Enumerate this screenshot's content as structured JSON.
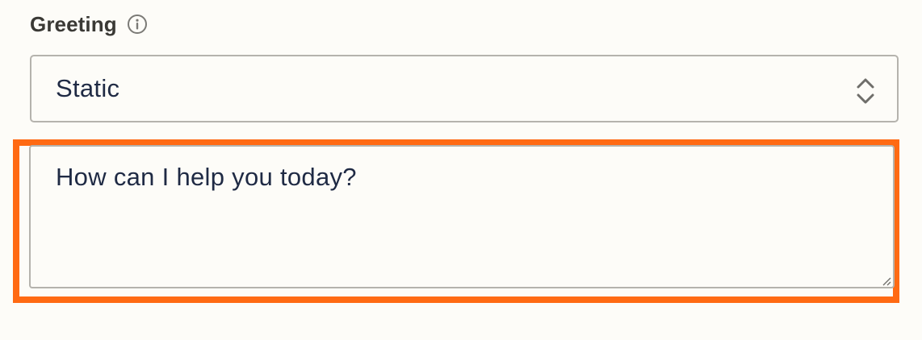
{
  "field": {
    "label": "Greeting",
    "info_icon": "info-circle-icon"
  },
  "select": {
    "value": "Static",
    "icon": "chevron-up-down-icon"
  },
  "textarea": {
    "value": "How can I help you today?",
    "resize_icon": "resize-handle-icon"
  },
  "colors": {
    "highlight": "#ff6a13",
    "text": "#1f2a44",
    "label": "#3a3935",
    "border": "#b5b3ad",
    "background": "#fdfcf8"
  }
}
